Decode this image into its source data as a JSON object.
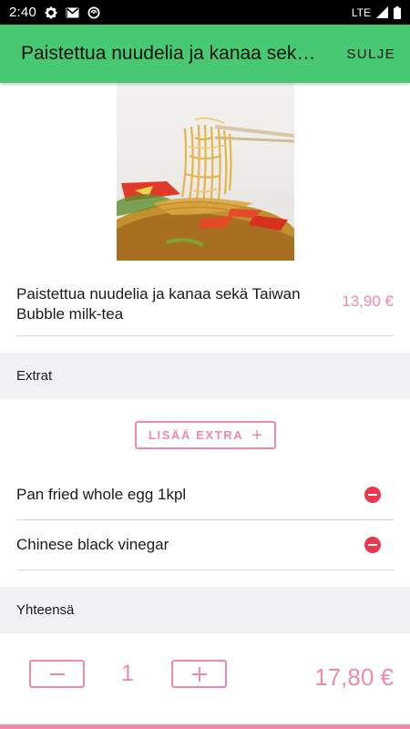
{
  "status_bar": {
    "time": "2:40",
    "network": "LTE",
    "icons": [
      "gear-icon",
      "gmail-icon",
      "sync-icon",
      "signal-icon",
      "battery-icon"
    ]
  },
  "app_bar": {
    "title": "Paistettua nuudelia ja kanaa sekä Taiwan Bubble milk-tea",
    "close_label": "SULJE"
  },
  "product": {
    "image": "noodle-dish-photo",
    "name": "Paistettua nuudelia ja kanaa sekä Taiwan Bubble milk-tea",
    "price": "13,90 €"
  },
  "extras": {
    "header": "Extrat",
    "add_label": "LISÄÄ EXTRA",
    "items": [
      {
        "name": "Pan fried whole egg 1kpl"
      },
      {
        "name": "Chinese black vinegar"
      }
    ]
  },
  "total": {
    "header": "Yhteensä",
    "quantity": "1",
    "price": "17,80 €"
  },
  "colors": {
    "app_bar": "#47c873",
    "accent": "#f08aa8",
    "remove": "#e8394f",
    "section_bg": "#f2f2f5"
  }
}
